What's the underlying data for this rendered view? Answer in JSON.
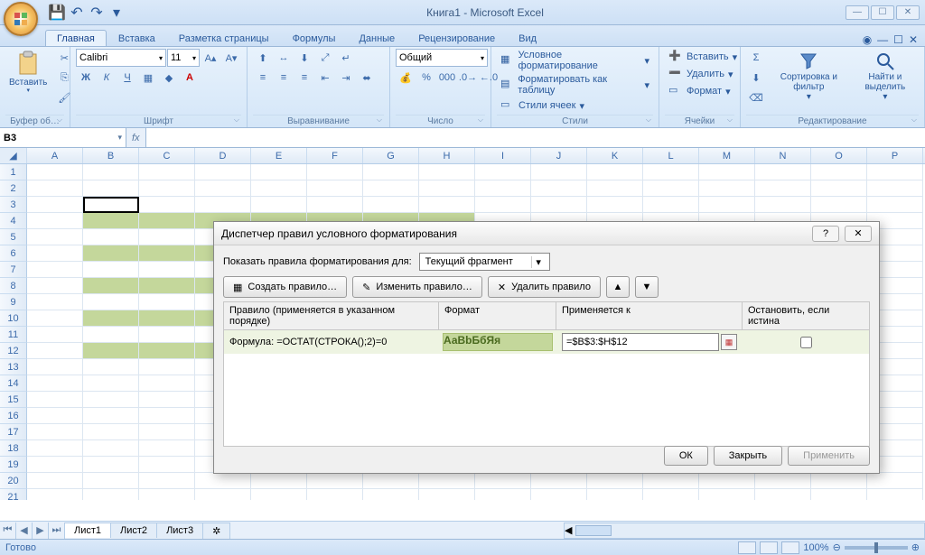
{
  "window": {
    "title": "Книга1 - Microsoft Excel"
  },
  "qat": {
    "save": "💾",
    "undo": "↶",
    "redo": "↷"
  },
  "tabs": [
    "Главная",
    "Вставка",
    "Разметка страницы",
    "Формулы",
    "Данные",
    "Рецензирование",
    "Вид"
  ],
  "ribbon": {
    "clipboard": {
      "paste": "Вставить",
      "label": "Буфер об…"
    },
    "font": {
      "name": "Calibri",
      "size": "11",
      "label": "Шрифт"
    },
    "align": {
      "label": "Выравнивание"
    },
    "number": {
      "format": "Общий",
      "label": "Число"
    },
    "styles": {
      "cond_format": "Условное форматирование",
      "format_table": "Форматировать как таблицу",
      "cell_styles": "Стили ячеек",
      "label": "Стили"
    },
    "cells": {
      "insert": "Вставить",
      "delete": "Удалить",
      "format": "Формат",
      "label": "Ячейки"
    },
    "editing": {
      "sort": "Сортировка и фильтр",
      "find": "Найти и выделить",
      "label": "Редактирование"
    }
  },
  "name_box": "B3",
  "columns": [
    "A",
    "B",
    "C",
    "D",
    "E",
    "F",
    "G",
    "H",
    "I",
    "J",
    "K",
    "L",
    "M",
    "N",
    "O",
    "P"
  ],
  "row_count": 21,
  "green_rows": [
    4,
    6,
    8,
    10,
    12
  ],
  "sheets": [
    "Лист1",
    "Лист2",
    "Лист3"
  ],
  "status": {
    "ready": "Готово",
    "zoom": "100%"
  },
  "dialog": {
    "title": "Диспетчер правил условного форматирования",
    "show_rules_for_label": "Показать правила форматирования для:",
    "show_rules_for_value": "Текущий фрагмент",
    "new_rule": "Создать правило…",
    "edit_rule": "Изменить правило…",
    "delete_rule": "Удалить правило",
    "col_rule": "Правило (применяется в указанном порядке)",
    "col_format": "Формат",
    "col_applies": "Применяется к",
    "col_stop": "Остановить, если истина",
    "rule_text": "Формула: =ОСТАТ(СТРОКА();2)=0",
    "preview": "АаBbБбЯя",
    "applies_to": "=$B$3:$H$12",
    "ok": "ОК",
    "close": "Закрыть",
    "apply": "Применить"
  }
}
